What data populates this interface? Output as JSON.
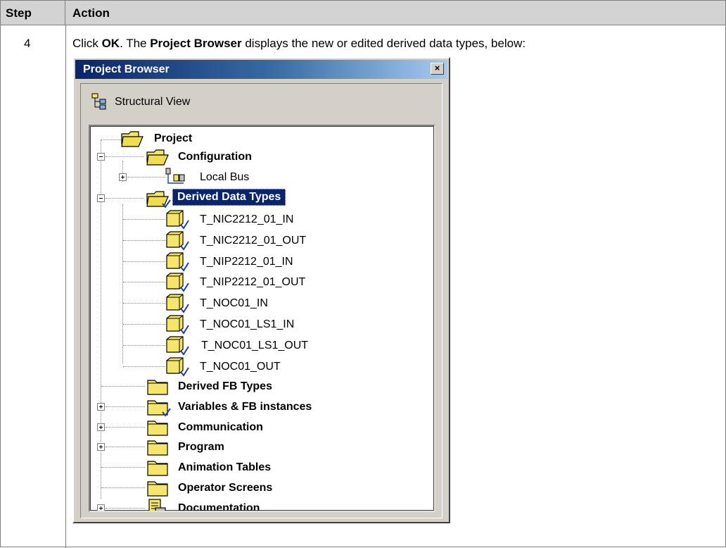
{
  "table": {
    "header": {
      "step": "Step",
      "action": "Action"
    },
    "row": {
      "step": "4",
      "action_parts": [
        "Click ",
        "OK",
        ". The ",
        "Project Browser",
        " displays the new or edited derived data types, below:"
      ]
    }
  },
  "window": {
    "title": "Project Browser",
    "close_glyph": "×",
    "view_label": "Structural View"
  },
  "tree": {
    "root": "Project",
    "configuration": "Configuration",
    "local_bus": "Local Bus",
    "derived_data_types": "Derived Data Types",
    "ddt_items": [
      "T_NIC2212_01_IN",
      "T_NIC2212_01_OUT",
      "T_NIP2212_01_IN",
      "T_NIP2212_01_OUT",
      "T_NOC01_IN",
      "T_NOC01_LS1_IN",
      "T_NOC01_LS1_OUT",
      "T_NOC01_OUT"
    ],
    "folders": [
      "Derived FB Types",
      "Variables & FB instances",
      "Communication",
      "Program",
      "Animation Tables",
      "Operator Screens",
      "Documentation"
    ]
  },
  "colors": {
    "header_bg": "#d3d3d3",
    "title_gradient_start": "#0a246a",
    "title_gradient_end": "#a6caf0",
    "selection": "#0a246a",
    "folder": "#f5e66a",
    "check": "#1a3fb0"
  },
  "icons": {
    "window_close": "close-icon",
    "structural_view": "structural-view-icon",
    "folder": "folder-icon",
    "open_folder": "open-folder-icon",
    "data_type": "data-type-icon",
    "local_bus": "local-bus-icon",
    "documentation": "documentation-icon"
  }
}
